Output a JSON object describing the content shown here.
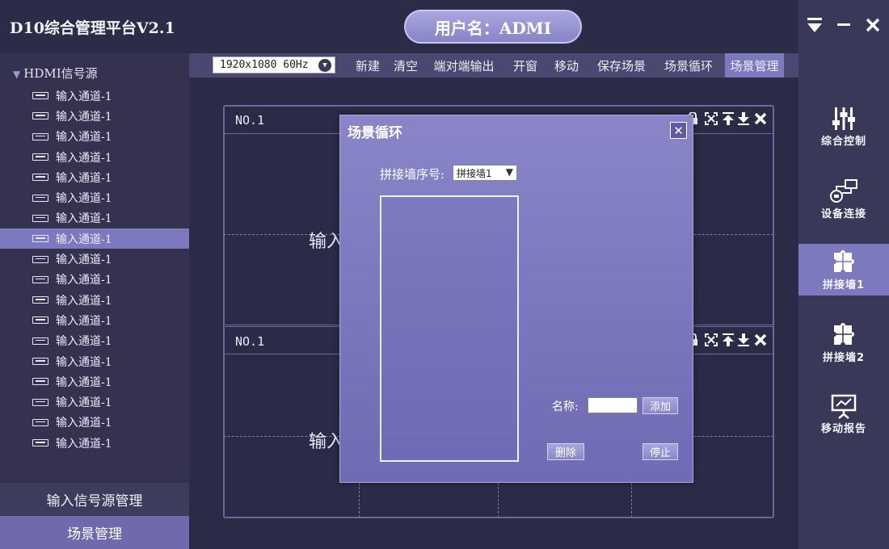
{
  "app": {
    "title": "D10综合管理平台V2.1",
    "user_label": "用户名：ADMI"
  },
  "window_controls": {
    "menu_icon": "menu-down-icon",
    "minimize_icon": "minimize-icon",
    "close_icon": "close-icon"
  },
  "sidebar": {
    "root_label": "HDMI信号源",
    "items": [
      "输入通道-1",
      "输入通道-1",
      "输入通道-1",
      "输入通道-1",
      "输入通道-1",
      "输入通道-1",
      "输入通道-1",
      "输入通道-1",
      "输入通道-1",
      "输入通道-1",
      "输入通道-1",
      "输入通道-1",
      "输入通道-1",
      "输入通道-1",
      "输入通道-1",
      "输入通道-1",
      "输入通道-1",
      "输入通道-1"
    ],
    "selected_index": 7,
    "source_btn": "输入信号源管理",
    "scene_btn": "场景管理"
  },
  "toolbar": {
    "resolution": "1920x1080 60Hz",
    "buttons": [
      "新建",
      "清空",
      "端对端输出",
      "开窗",
      "移动",
      "保存场景",
      "场景循环",
      "场景管理"
    ],
    "active": "场景管理"
  },
  "windows": [
    {
      "no": "NO.1",
      "input": "输入"
    },
    {
      "no": "NO.1",
      "input": "输入"
    }
  ],
  "right_nav": {
    "items": [
      "综合控制",
      "设备连接",
      "拼接墙1",
      "拼接墙2",
      "移动报告"
    ],
    "selected_index": 2
  },
  "dialog": {
    "title": "场景循环",
    "wall_label": "拼接墙序号:",
    "wall_value": "拼接墙1",
    "name_label": "名称:",
    "name_value": "",
    "add_btn": "添加",
    "delete_btn": "删除",
    "stop_btn": "停止"
  },
  "colors": {
    "accent": "#7d79bf",
    "background": "#2a2944",
    "dialog": "#8985c8"
  }
}
